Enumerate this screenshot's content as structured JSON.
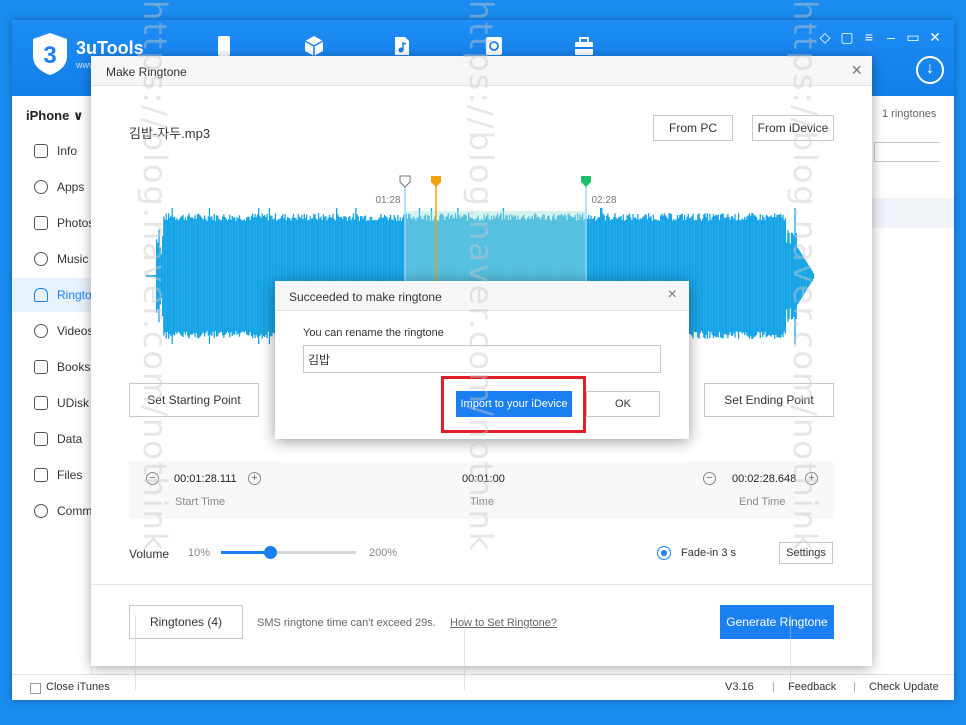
{
  "app": {
    "logo_text": "3uTools",
    "logo_sub": "www",
    "device_name": "iPhone ∨",
    "colors": {
      "brand": "#1a7ff0",
      "highlight": "#e01f28"
    }
  },
  "sidebar": {
    "items": [
      {
        "label": "Info",
        "icon": "phone-icon"
      },
      {
        "label": "Apps",
        "icon": "apps-icon"
      },
      {
        "label": "Photos",
        "icon": "photos-icon"
      },
      {
        "label": "Music",
        "icon": "music-icon"
      },
      {
        "label": "Ringtones",
        "icon": "bell-icon",
        "active": true
      },
      {
        "label": "Videos",
        "icon": "video-icon"
      },
      {
        "label": "Books",
        "icon": "book-icon"
      },
      {
        "label": "UDisk",
        "icon": "udisk-icon"
      },
      {
        "label": "Data",
        "icon": "data-icon"
      },
      {
        "label": "Files",
        "icon": "folder-icon"
      },
      {
        "label": "Common",
        "icon": "common-icon"
      }
    ]
  },
  "right_panel": {
    "count": "1 ringtones"
  },
  "statusbar": {
    "close_itunes": "Close iTunes",
    "version": "V3.16",
    "feedback": "Feedback",
    "check_update": "Check Update",
    "separator": "|"
  },
  "ringtone_dialog": {
    "title": "Make Ringtone",
    "close": "×",
    "file_name": "김밥-자두.mp3",
    "from_pc": "From PC",
    "from_idevice": "From iDevice",
    "marker_start_time": "01:28",
    "marker_end_time": "02:28",
    "set_start": "Set Starting Point",
    "set_end": "Set Ending Point",
    "start_time": "00:01:28.111",
    "start_label": "Start Time",
    "duration": "00:01:00",
    "duration_label": "Time",
    "end_time": "00:02:28.648",
    "end_label": "End Time",
    "volume_label": "Volume",
    "volume_min": "10%",
    "volume_max": "200%",
    "volume_level": 0.36,
    "fade_label": "Fade-in 3 s",
    "settings": "Settings",
    "ringtones_btn": "Ringtones (4)",
    "sms_note": "SMS ringtone time can't exceed 29s.",
    "how_link": "How to Set Ringtone?",
    "generate": "Generate Ringtone"
  },
  "success_modal": {
    "title": "Succeeded to make ringtone",
    "close": "×",
    "prompt": "You can rename the ringtone",
    "name_value": "김밥",
    "import_btn": "Import to your iDevice",
    "ok_btn": "OK"
  },
  "watermark": {
    "text": "https://blog.naver.com/nothink"
  }
}
